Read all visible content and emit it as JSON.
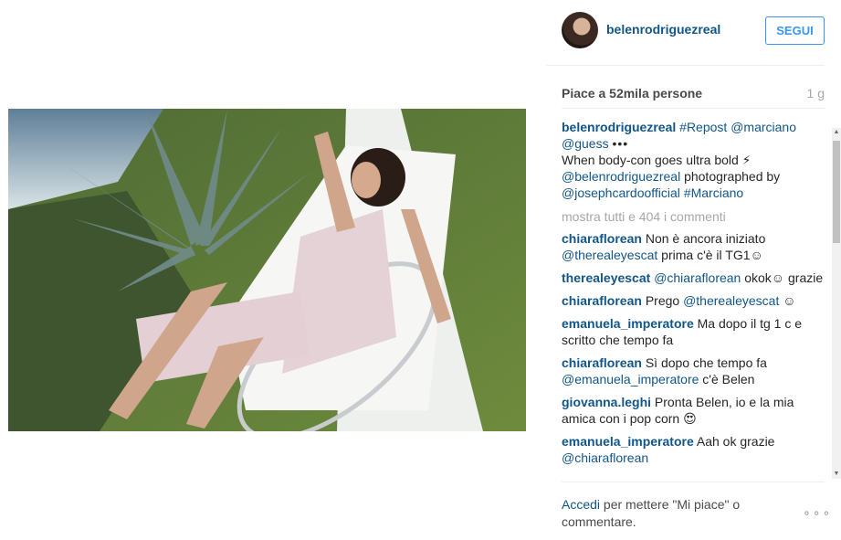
{
  "post": {
    "username": "belenrodriguezreal",
    "follow_label": "SEGUI",
    "likes": "Piace a 52mila persone",
    "time": "1 g",
    "caption": {
      "user": "belenrodriguezreal",
      "tag1": "#Repost",
      "mention1": "@marciano",
      "mention2": "@guess",
      "dots": "•••",
      "line2": "When body-con goes ultra bold ⚡",
      "mention3": "@belenrodriguezreal",
      "text3": " photographed by",
      "mention4": "@josephcardoofficial",
      "tag2": "#Marciano"
    },
    "show_all": "mostra tutti e 404 i commenti"
  },
  "comments": [
    {
      "user": "chiaraflorean",
      "text": "Non è ancora iniziato",
      "mention": "@therealeyescat",
      "text2": " prima c'è il TG1☺"
    },
    {
      "user": "therealeyescat",
      "text": "",
      "mention": "@chiaraflorean",
      "text2": " okok☺ grazie"
    },
    {
      "user": "chiaraflorean",
      "text": "Prego",
      "mention": "@therealeyescat",
      "text2": " ☺"
    },
    {
      "user": "emanuela_imperatore",
      "text": "Ma dopo il tg 1 c e scritto che tempo fa",
      "mention": "",
      "text2": ""
    },
    {
      "user": "chiaraflorean",
      "text": "Sì dopo che tempo fa",
      "mention": "@emanuela_imperatore",
      "text2": " c'è Belen"
    },
    {
      "user": "giovanna.leghi",
      "text": "Pronta Belen, io e la mia amica con i pop corn 😍",
      "mention": "",
      "text2": ""
    },
    {
      "user": "emanuela_imperatore",
      "text": "Aah ok grazie",
      "mention": "@chiaraflorean",
      "text2": ""
    }
  ],
  "footer": {
    "like_link": "Accedi",
    "text": " per mettere \"Mi piace\" o commentare.",
    "options": "∘∘∘"
  },
  "colors": {
    "link": "#125688",
    "follow": "#3897f0",
    "muted": "#a5a7aa"
  }
}
